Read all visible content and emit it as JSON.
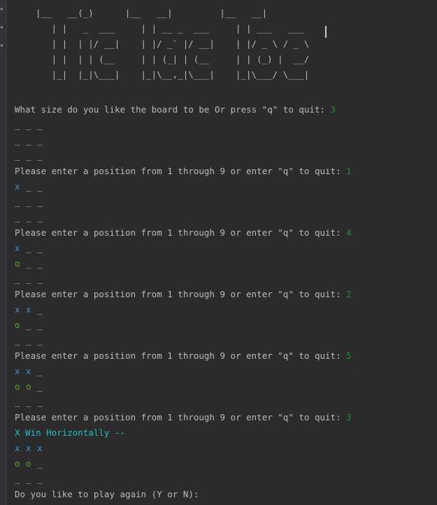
{
  "banner": " ------- -        -------           -------\n|__   __(_)      |__   __|         |__   __|\n   | |   _  ___     | | __ _  ___     | | ___   ___\n   | |  | |/ __|    | |/ _` |/ __|    | |/ _ \\ / _ \\\n   | |  | | (__     | | (_| | (__     | | (_) |  __/\n   |_|  |_|\\___|    |_|\\__,_|\\___|    |_|\\___/ \\___|",
  "size_prompt": "What size do you like the board to be Or press \"q\" to quit: ",
  "size_input": "3",
  "move_prompt": "Please enter a position from 1 through 9 or enter \"q\" to quit: ",
  "boards": [
    [
      [
        "_",
        "_",
        "_"
      ],
      [
        "_",
        "_",
        "_"
      ],
      [
        "_",
        "_",
        "_"
      ]
    ],
    [
      [
        "x",
        "_",
        "_"
      ],
      [
        "_",
        "_",
        "_"
      ],
      [
        "_",
        "_",
        "_"
      ]
    ],
    [
      [
        "x",
        "_",
        "_"
      ],
      [
        "o",
        "_",
        "_"
      ],
      [
        "_",
        "_",
        "_"
      ]
    ],
    [
      [
        "x",
        "x",
        "_"
      ],
      [
        "o",
        "_",
        "_"
      ],
      [
        "_",
        "_",
        "_"
      ]
    ],
    [
      [
        "x",
        "x",
        "_"
      ],
      [
        "o",
        "o",
        "_"
      ],
      [
        "_",
        "_",
        "_"
      ]
    ],
    [
      [
        "x",
        "x",
        "x"
      ],
      [
        "o",
        "o",
        "_"
      ],
      [
        "_",
        "_",
        "_"
      ]
    ]
  ],
  "moves": [
    "1",
    "4",
    "2",
    "5",
    "3"
  ],
  "win_message": "X Win Horizontally --",
  "play_again_prompt": "Do you like to play again (Y or N): ",
  "colors": {
    "background": "#2b2b2b",
    "text": "#bbbbbb",
    "x_mark": "#3f8fd2",
    "o_mark": "#6a9a2a",
    "user_input": "#1d8f2a",
    "win_text": "#20c0c0"
  }
}
